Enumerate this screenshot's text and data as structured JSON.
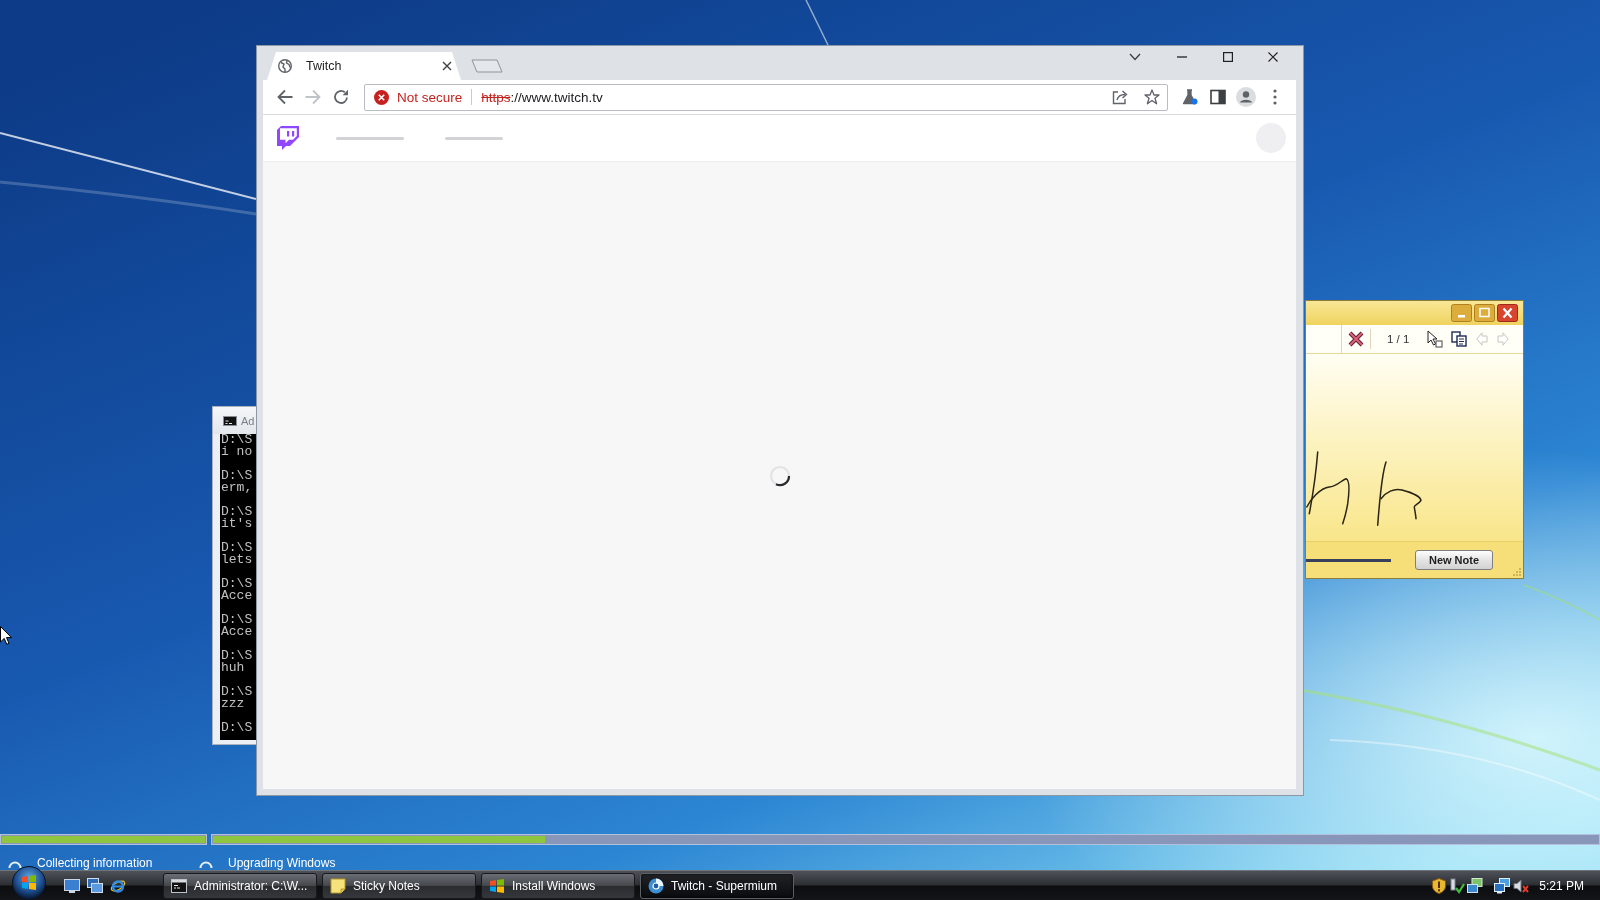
{
  "browser": {
    "tabs": [
      {
        "title": "Twitch",
        "selected": true
      }
    ],
    "navigation": [
      {
        "kind": "back",
        "disabled": false
      },
      {
        "kind": "forward",
        "disabled": true
      },
      {
        "kind": "reload",
        "disabled": false
      }
    ],
    "address_bar": {
      "security_label": "Not secure",
      "scheme": "https",
      "rest": "://www.twitch.tv"
    },
    "page": {
      "loading": true
    }
  },
  "cmd_window": {
    "title": "Ad",
    "entries": [
      {
        "prompt": "D:\\S",
        "output": "i no"
      },
      {
        "prompt": "D:\\S",
        "output": "erm,"
      },
      {
        "prompt": "D:\\S",
        "output": "it's"
      },
      {
        "prompt": "D:\\S",
        "output": "lets"
      },
      {
        "prompt": "D:\\S",
        "output": "Acce"
      },
      {
        "prompt": "D:\\S",
        "output": "Acce"
      },
      {
        "prompt": "D:\\S",
        "output": "huh"
      },
      {
        "prompt": "D:\\S",
        "output": "zzz"
      },
      {
        "prompt": "D:\\S"
      }
    ]
  },
  "sticky_notes": {
    "counter": "1 / 1",
    "nav": [
      {
        "kind": "previous",
        "disabled": true
      },
      {
        "kind": "next",
        "disabled": true
      }
    ],
    "new_note_button": "New Note"
  },
  "setup": {
    "steps": [
      {
        "label": "Collecting information",
        "level": 1
      },
      {
        "label": "Upgrading Windows",
        "level": 0.24
      }
    ]
  },
  "taskbar": {
    "buttons": [
      {
        "kind": "console",
        "label": "Administrator: C:\\W...",
        "selected": false
      },
      {
        "kind": "sticky",
        "label": "Sticky Notes",
        "selected": false
      },
      {
        "kind": "setup",
        "label": "Install Windows",
        "selected": false
      },
      {
        "kind": "browser",
        "label": "Twitch - Supermium",
        "selected": true
      }
    ],
    "clock": "5:21 PM"
  }
}
